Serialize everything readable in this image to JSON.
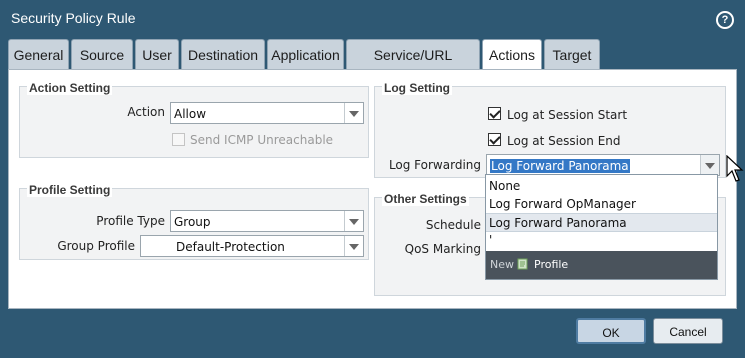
{
  "window": {
    "title": "Security Policy Rule",
    "help_label": "?"
  },
  "tabs": [
    {
      "label": "General"
    },
    {
      "label": "Source"
    },
    {
      "label": "User"
    },
    {
      "label": "Destination"
    },
    {
      "label": "Application"
    },
    {
      "label": "Service/URL Category"
    },
    {
      "label": "Actions",
      "active": true
    },
    {
      "label": "Target"
    }
  ],
  "action_setting": {
    "title": "Action Setting",
    "action_label": "Action",
    "action_value": "Allow",
    "icmp_label": "Send ICMP Unreachable",
    "icmp_checked": false
  },
  "log_setting": {
    "title": "Log Setting",
    "session_start_label": "Log at Session Start",
    "session_start_checked": true,
    "session_end_label": "Log at Session End",
    "session_end_checked": true,
    "forwarding_label": "Log Forwarding",
    "forwarding_value": "Log Forward Panorama"
  },
  "profile_setting": {
    "title": "Profile Setting",
    "profile_type_label": "Profile Type",
    "profile_type_value": "Group",
    "group_profile_label": "Group Profile",
    "group_profile_value": "Default-Protection"
  },
  "other_settings": {
    "title": "Other Settings",
    "schedule_label": "Schedule",
    "qos_label": "QoS Marking"
  },
  "dropdown": {
    "options": [
      "None",
      "Log Forward OpManager",
      "Log Forward Panorama",
      "'"
    ],
    "hover_index": 2,
    "footer_new": "New",
    "footer_profile": "Profile"
  },
  "buttons": {
    "ok": "OK",
    "cancel": "Cancel"
  },
  "colors": {
    "titlebar": "#2e5873",
    "selection": "#3478c6",
    "tab": "#c9d3dc",
    "dropdown_footer": "#4a535c"
  }
}
